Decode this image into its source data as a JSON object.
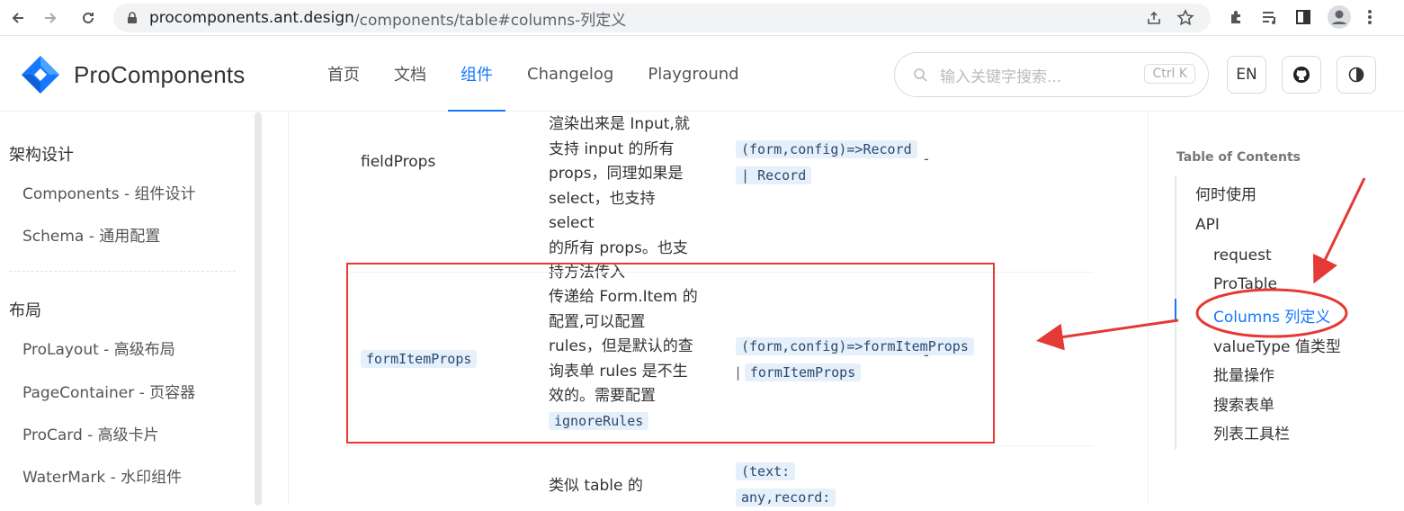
{
  "browser": {
    "url_domain": "procomponents.ant.design",
    "url_path": "/components/table#columns-列定义"
  },
  "header": {
    "brand": "ProComponents",
    "nav": [
      "首页",
      "文档",
      "组件",
      "Changelog",
      "Playground"
    ],
    "active_nav_index": 2,
    "search_placeholder": "输入关键字搜索...",
    "search_shortcut": "Ctrl K",
    "lang_button": "EN"
  },
  "sidebar": {
    "groups": [
      {
        "title": "架构设计",
        "items": [
          "Components - 组件设计",
          "Schema - 通用配置"
        ]
      },
      {
        "title": "布局",
        "items": [
          "ProLayout - 高级布局",
          "PageContainer - 页容器",
          "ProCard - 高级卡片",
          "WaterMark - 水印组件"
        ]
      }
    ]
  },
  "table": {
    "rows": [
      {
        "name": "fieldProps",
        "description_lines": [
          "渲染出来是 Input,就",
          "支持 input 的所有",
          "props，同理如果是",
          "select，也支持 select",
          "的所有 props。也支",
          "持方法传入"
        ],
        "type_parts": [
          "(form,config)=>Record",
          "Record"
        ],
        "default": "-"
      },
      {
        "name": "formItemProps",
        "description_lines": [
          "传递给 Form.Item 的",
          "配置,可以配置",
          "rules，但是默认的查",
          "询表单 rules 是不生",
          "效的。需要配置"
        ],
        "description_code": "ignoreRules",
        "type_parts": [
          "(form,config)=>formItemProps",
          "formItemProps"
        ],
        "default": "-"
      },
      {
        "name": "",
        "description_lines": [
          "类似 table 的"
        ],
        "type_parts": [
          "(text:",
          "any,record:"
        ],
        "default": ""
      }
    ]
  },
  "toc": {
    "title": "Table of Contents",
    "items": [
      {
        "label": "何时使用",
        "level": 1
      },
      {
        "label": "API",
        "level": 1
      },
      {
        "label": "request",
        "level": 2
      },
      {
        "label": "ProTable",
        "level": 2
      },
      {
        "label": "Columns 列定义",
        "level": 2,
        "active": true
      },
      {
        "label": "valueType 值类型",
        "level": 2
      },
      {
        "label": "批量操作",
        "level": 2
      },
      {
        "label": "搜索表单",
        "level": 2
      },
      {
        "label": "列表工具栏",
        "level": 2
      }
    ]
  },
  "colors": {
    "accent": "#1677ff",
    "annotation_red": "#e53935"
  }
}
